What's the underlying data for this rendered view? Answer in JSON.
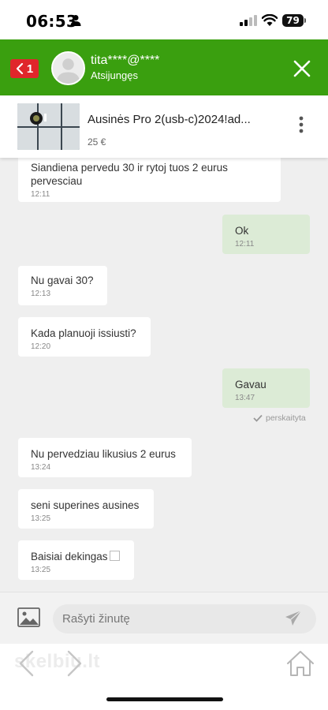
{
  "status_bar": {
    "time": "06:53",
    "battery": "79"
  },
  "header": {
    "unread_count": "1",
    "user_name": "tita****@****",
    "user_status": "Atsijungęs"
  },
  "listing": {
    "title": "Ausinės Pro 2(usb-c)2024!ad...",
    "price": "25 €"
  },
  "messages": [
    {
      "direction": "in",
      "text": "Siandiena pervedu 30 ir rytoj tuos 2 eurus pervesciau",
      "time": "12:11"
    },
    {
      "direction": "out",
      "text": "Ok",
      "time": "12:11"
    },
    {
      "direction": "in",
      "text": "Nu gavai 30?",
      "time": "12:13"
    },
    {
      "direction": "in",
      "text": "Kada planuoji issiusti?",
      "time": "12:20"
    },
    {
      "direction": "out",
      "text": "Gavau",
      "time": "13:47"
    },
    {
      "direction": "in",
      "text": "Nu pervedziau likusius 2 eurus",
      "time": "13:24"
    },
    {
      "direction": "in",
      "text": "seni superines ausines",
      "time": "13:25"
    },
    {
      "direction": "in",
      "text": "Baisiai dekingas",
      "time": "13:25"
    }
  ],
  "read_receipt": "perskaityta",
  "composer": {
    "placeholder": "Rašyti žinutę"
  },
  "bottom_nav": {
    "logo": "skelbiu.lt"
  },
  "colors": {
    "header_green": "#3a9f0f",
    "badge_red": "#e0262b",
    "outgoing_bubble": "#dcebd6"
  }
}
